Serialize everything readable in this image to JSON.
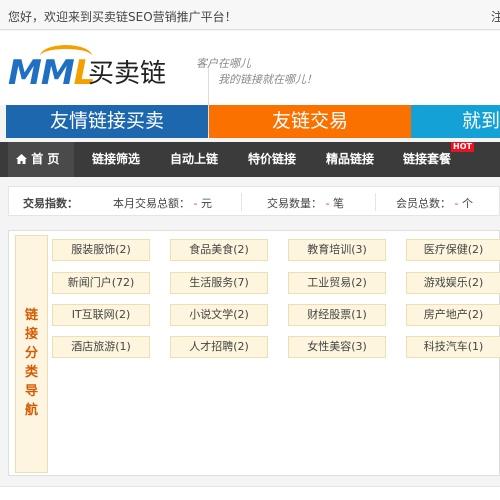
{
  "topbar": {
    "welcome": "您好，欢迎来到买卖链SEO营销推广平台！",
    "right_text": "注"
  },
  "header": {
    "logo_mm": "MM",
    "logo_l": "L",
    "logo_cn": "买卖链",
    "slogan_line1": "客户在哪儿",
    "slogan_line2": "我的链接就在哪儿！"
  },
  "banners": {
    "friend_link_trade": "友情链接买卖",
    "link_trade": "友链交易",
    "jump": "就到"
  },
  "nav": {
    "home": "首 页",
    "items": [
      "链接筛选",
      "自动上链",
      "特价链接",
      "精品链接",
      "链接套餐"
    ],
    "hot_badge": "HOT"
  },
  "stats": {
    "index_label": "交易指数：",
    "month_total_label": "本月交易总额：",
    "month_total_value": "-",
    "month_total_unit": "元",
    "count_label": "交易数量：",
    "count_value": "-",
    "count_unit": "笔",
    "members_label": "会员总数：",
    "members_value": "-",
    "members_unit": "个"
  },
  "category_nav": {
    "title": "链接分类导航",
    "tags": [
      "服装服饰(2)",
      "食品美食(2)",
      "教育培训(3)",
      "医疗保健(2)",
      "新闻门户(72)",
      "生活服务(7)",
      "工业贸易(2)",
      "游戏娱乐(2)",
      "IT互联网(2)",
      "小说文学(2)",
      "财经股票(1)",
      "房产地产(2)",
      "酒店旅游(1)",
      "人才招聘(2)",
      "女性美容(3)",
      "科技汽车(1)"
    ]
  },
  "colors": {
    "brand_blue": "#1d67ae",
    "brand_orange": "#fb7100",
    "brand_cyan": "#13a1d6",
    "nav_dark": "#3b3b3b",
    "accent_red": "#e33"
  },
  "icons": {
    "home": "home-icon"
  }
}
